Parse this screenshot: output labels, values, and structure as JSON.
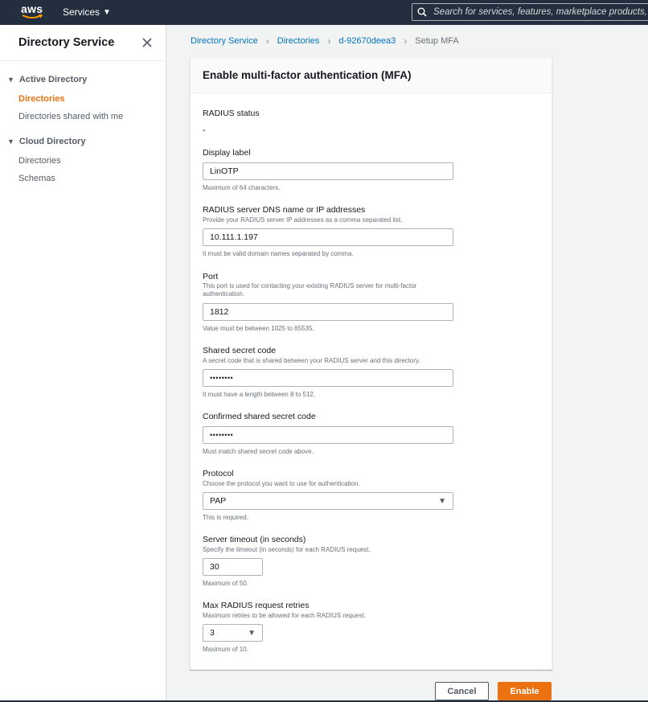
{
  "topnav": {
    "logo_text": "aws",
    "services_label": "Services",
    "search_placeholder": "Search for services, features, marketplace products, and docs"
  },
  "sidebar": {
    "title": "Directory Service",
    "groups": [
      {
        "label": "Active Directory",
        "items": [
          {
            "label": "Directories",
            "active": true
          },
          {
            "label": "Directories shared with me"
          }
        ]
      },
      {
        "label": "Cloud Directory",
        "items": [
          {
            "label": "Directories"
          },
          {
            "label": "Schemas"
          }
        ]
      }
    ]
  },
  "breadcrumb": [
    "Directory Service",
    "Directories",
    "d-92670deea3",
    "Setup MFA"
  ],
  "panel": {
    "title": "Enable multi-factor authentication (MFA)",
    "radius_status": {
      "label": "RADIUS status",
      "value": "-"
    },
    "display_label": {
      "label": "Display label",
      "value": "LinOTP",
      "hint": "Maximum of 64 characters."
    },
    "radius_server": {
      "label": "RADIUS server DNS name or IP addresses",
      "desc": "Provide your RADIUS server IP addresses as a comma separated list.",
      "value": "10.111.1.197",
      "hint": "It must be valid domain names separated by comma."
    },
    "port": {
      "label": "Port",
      "desc": "This port is used for contacting your existing RADIUS server for multi-factor authentication.",
      "value": "1812",
      "hint": "Value must be between 1025 to 65535."
    },
    "shared_secret": {
      "label": "Shared secret code",
      "desc": "A secret code that is shared between your RADIUS server and this directory.",
      "value": "••••••••",
      "hint": "It must have a length between 8 to 512."
    },
    "confirm_secret": {
      "label": "Confirmed shared secret code",
      "value": "••••••••",
      "hint": "Must match shared secret code above."
    },
    "protocol": {
      "label": "Protocol",
      "desc": "Choose the protocol you want to use for authentication.",
      "value": "PAP",
      "hint": "This is required."
    },
    "timeout": {
      "label": "Server timeout (in seconds)",
      "desc": "Specify the timeout (in seconds) for each RADIUS request.",
      "value": "30",
      "hint": "Maximum of 50."
    },
    "retries": {
      "label": "Max RADIUS request retries",
      "desc": "Maximum retries to be allowed for each RADIUS request.",
      "value": "3",
      "hint": "Maximum of 10."
    }
  },
  "actions": {
    "cancel_label": "Cancel",
    "enable_label": "Enable"
  },
  "colors": {
    "nav_bg": "#232f3e",
    "accent": "#ec7211",
    "link": "#0073bb"
  }
}
